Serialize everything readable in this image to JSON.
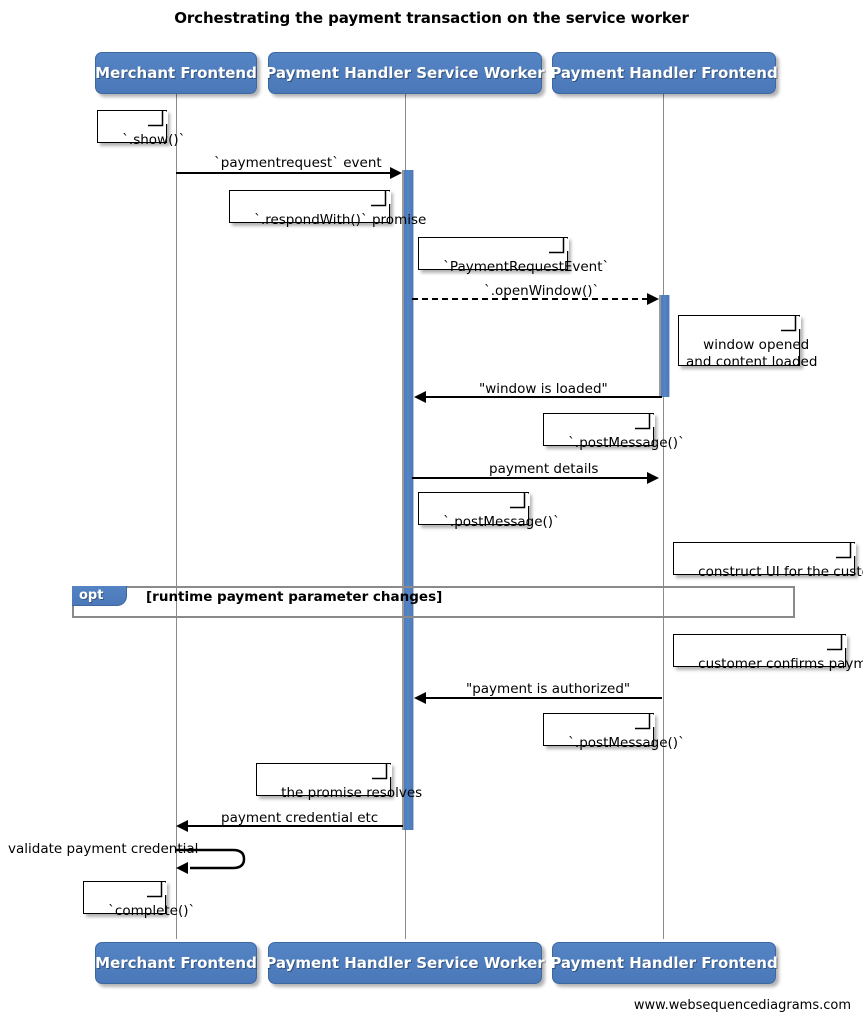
{
  "title": "Orchestrating the payment transaction on the service worker",
  "footer": "www.websequencediagrams.com",
  "colors": {
    "participant_fill": "#5181C1",
    "participant_text": "#FFFFFF",
    "activation_fill": "#5181C1",
    "lifeline": "#8B8B8B",
    "fragment_border": "#8A8A8A",
    "note_fill": "#FFFFFF",
    "arrow": "#000000"
  },
  "participants": [
    {
      "id": "merchant-frontend",
      "label": "Merchant Frontend"
    },
    {
      "id": "payment-handler-service-worker",
      "label": "Payment Handler Service Worker"
    },
    {
      "id": "payment-handler-frontend",
      "label": "Payment Handler Frontend"
    }
  ],
  "participants_bottom": [
    {
      "id": "merchant-frontend",
      "label": "Merchant Frontend"
    },
    {
      "id": "payment-handler-service-worker",
      "label": "Payment Handler Service Worker"
    },
    {
      "id": "payment-handler-frontend",
      "label": "Payment Handler Frontend"
    }
  ],
  "messages": [
    {
      "id": "paymentrequest-event",
      "label": "`paymentrequest` event",
      "from": "merchant-frontend",
      "to": "payment-handler-service-worker",
      "style": "solid",
      "direction": "right"
    },
    {
      "id": "open-window",
      "label": "`.openWindow()`",
      "from": "payment-handler-service-worker",
      "to": "payment-handler-frontend",
      "style": "dashed",
      "direction": "right"
    },
    {
      "id": "window-is-loaded",
      "label": "\"window is loaded\"",
      "from": "payment-handler-frontend",
      "to": "payment-handler-service-worker",
      "style": "solid",
      "direction": "left"
    },
    {
      "id": "payment-details",
      "label": "payment details",
      "from": "payment-handler-service-worker",
      "to": "payment-handler-frontend",
      "style": "solid",
      "direction": "right"
    },
    {
      "id": "payment-is-authorized",
      "label": "\"payment is authorized\"",
      "from": "payment-handler-frontend",
      "to": "payment-handler-service-worker",
      "style": "solid",
      "direction": "left"
    },
    {
      "id": "payment-credential-etc",
      "label": "payment credential etc",
      "from": "payment-handler-service-worker",
      "to": "merchant-frontend",
      "style": "solid",
      "direction": "left"
    },
    {
      "id": "validate-payment-credential",
      "label": "validate payment credential",
      "from": "merchant-frontend",
      "to": "merchant-frontend",
      "style": "self",
      "direction": "left"
    }
  ],
  "notes": [
    {
      "id": "note-show",
      "text": "`.show()`"
    },
    {
      "id": "note-respondwith-promise",
      "text": "`.respondWith()` promise"
    },
    {
      "id": "note-paymentrequestevent",
      "text": "`PaymentRequestEvent`"
    },
    {
      "id": "note-window-opened",
      "text": "window opened\nand content loaded"
    },
    {
      "id": "note-postmessage-1",
      "text": "`.postMessage()`"
    },
    {
      "id": "note-postmessage-2",
      "text": "`.postMessage()`"
    },
    {
      "id": "note-construct-ui",
      "text": "construct UI for the customer"
    },
    {
      "id": "note-customer-confirms",
      "text": "customer confirms payment"
    },
    {
      "id": "note-postmessage-3",
      "text": "`.postMessage()`"
    },
    {
      "id": "note-promise-resolves",
      "text": "the promise resolves"
    },
    {
      "id": "note-complete",
      "text": "`complete()`"
    }
  ],
  "fragment": {
    "id": "opt-fragment",
    "operator": "opt",
    "condition": "[runtime payment parameter changes]"
  }
}
